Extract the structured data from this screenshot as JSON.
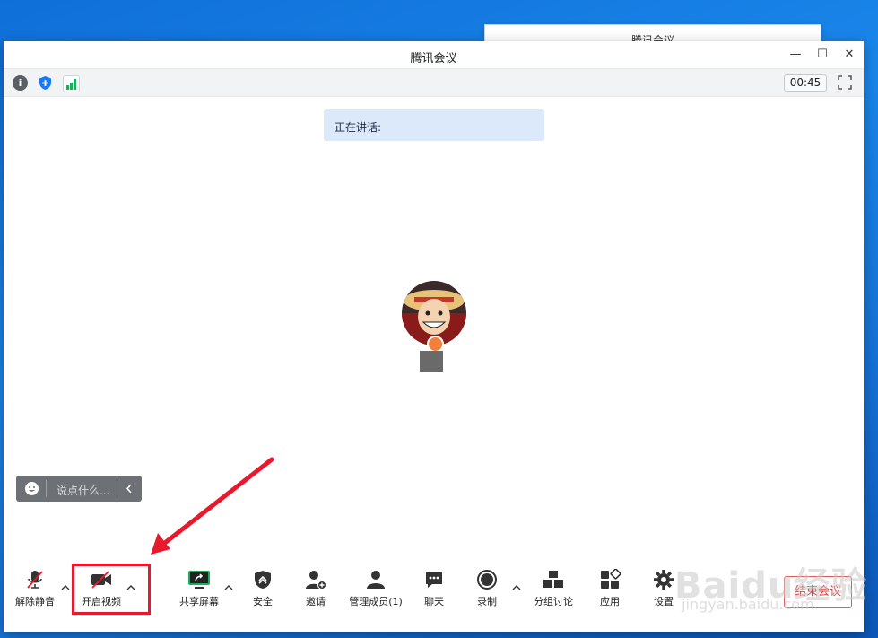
{
  "background_window": {
    "title": "腾讯会议",
    "controls": [
      "—",
      "✕"
    ]
  },
  "window": {
    "title": "腾讯会议",
    "minimize": "—",
    "maximize": "☐",
    "close": "✕"
  },
  "statusbar": {
    "info_icon": "i",
    "timer": "00:45"
  },
  "speaking": {
    "label": "正在讲话:"
  },
  "chat": {
    "placeholder": "说点什么..."
  },
  "toolbar": {
    "mute": "解除静音",
    "video": "开启视频",
    "share": "共享屏幕",
    "security": "安全",
    "invite": "邀请",
    "members": "管理成员(1)",
    "chat": "聊天",
    "record": "录制",
    "breakout": "分组讨论",
    "apps": "应用",
    "settings": "设置",
    "end": "结束会议"
  },
  "watermark": {
    "main": "Baidu经验",
    "sub": "jingyan.baidu.com"
  },
  "colors": {
    "accent": "#1677ff",
    "danger": "#e8192c",
    "share_green": "#1aad5b"
  }
}
